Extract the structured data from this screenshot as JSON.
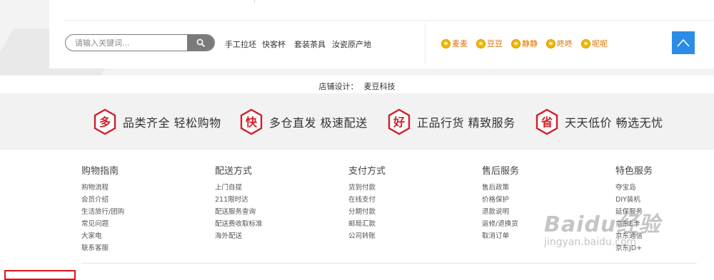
{
  "header": {
    "search": {
      "placeholder": "请输入关键词..."
    },
    "hot_keywords": [
      "手工拉坯",
      "快客杯",
      "套装茶具",
      "汝瓷原产地"
    ],
    "customer_service": [
      "麦麦",
      "豆豆",
      "静静",
      "咚咚",
      "呢呢"
    ],
    "back_to_top_icon": "chevron-up-icon"
  },
  "shop_design": {
    "label": "店铺设计：",
    "name": "麦豆科技"
  },
  "features": [
    {
      "badge": "多",
      "text": "品类齐全 轻松购物"
    },
    {
      "badge": "快",
      "text": "多仓直发 极速配送"
    },
    {
      "badge": "好",
      "text": "正品行货 精致服务"
    },
    {
      "badge": "省",
      "text": "天天低价 畅选无忧"
    }
  ],
  "footer_columns": [
    {
      "title": "购物指南",
      "links": [
        "购物流程",
        "会员介绍",
        "生活旅行/团购",
        "常见问题",
        "大家电",
        "联系客服"
      ]
    },
    {
      "title": "配送方式",
      "links": [
        "上门自提",
        "211限时达",
        "配送服务查询",
        "配送费收取标准",
        "海外配送"
      ]
    },
    {
      "title": "支付方式",
      "links": [
        "货到付款",
        "在线支付",
        "分期付款",
        "邮局汇款",
        "公司转账"
      ]
    },
    {
      "title": "售后服务",
      "links": [
        "售后政策",
        "价格保护",
        "退款说明",
        "返修/退换货",
        "取消订单"
      ]
    },
    {
      "title": "特色服务",
      "links": [
        "夺宝岛",
        "DIY装机",
        "延保服务",
        "京东E卡",
        "京东通信",
        "京东JD+"
      ]
    }
  ],
  "watermark": {
    "line1": "Baidu经验",
    "line2": "jingyan.baidu.com"
  },
  "colors": {
    "accent_red": "#d0202a",
    "back_to_top_blue": "#2b8ce6",
    "service_orange": "#e07000",
    "features_bg": "#f2f2f2"
  }
}
